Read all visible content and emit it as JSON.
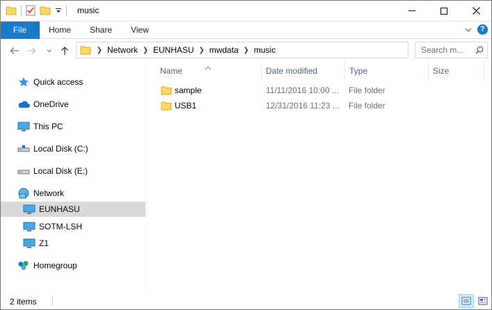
{
  "window": {
    "title": "music",
    "minimize_glyph": "—",
    "maximize_glyph": "☐",
    "close_glyph": "✕"
  },
  "ribbon": {
    "tabs": [
      {
        "label": "File"
      },
      {
        "label": "Home"
      },
      {
        "label": "Share"
      },
      {
        "label": "View"
      }
    ],
    "help_glyph": "?"
  },
  "address": {
    "crumbs": [
      "Network",
      "EUNHASU",
      "mwdata",
      "music"
    ]
  },
  "search": {
    "placeholder": "Search m..."
  },
  "nav": {
    "items": [
      {
        "label": "Quick access",
        "icon": "star-icon"
      },
      {
        "label": "OneDrive",
        "icon": "cloud-icon"
      },
      {
        "label": "This PC",
        "icon": "monitor-icon"
      },
      {
        "label": "Local Disk (C:)",
        "icon": "drive-icon"
      },
      {
        "label": "Local Disk (E:)",
        "icon": "drive-icon"
      },
      {
        "label": "Network",
        "icon": "network-icon"
      },
      {
        "label": "EUNHASU",
        "icon": "computer-icon",
        "selected": true
      },
      {
        "label": "SOTM-LSH",
        "icon": "computer-icon"
      },
      {
        "label": "Z1",
        "icon": "computer-icon"
      },
      {
        "label": "Homegroup",
        "icon": "homegroup-icon"
      }
    ]
  },
  "columns": {
    "name": "Name",
    "date": "Date modified",
    "type": "Type",
    "size": "Size"
  },
  "files": [
    {
      "name": "sample",
      "date": "11/11/2016 10:00 ...",
      "type": "File folder",
      "size": ""
    },
    {
      "name": "USB1",
      "date": "12/31/2016 11:23 ...",
      "type": "File folder",
      "size": ""
    }
  ],
  "status": {
    "count": "2 items"
  },
  "colors": {
    "accent": "#1979ca",
    "folder": "#ffd766",
    "selected": "#d9d9d9",
    "header_text": "#4c607a"
  }
}
